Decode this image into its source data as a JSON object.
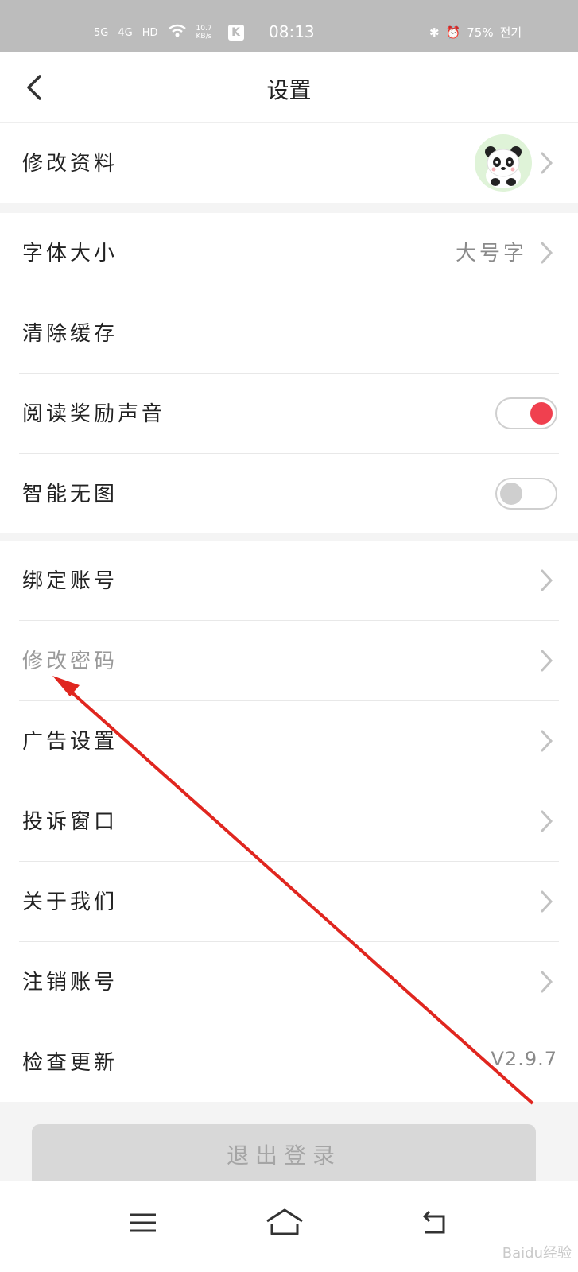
{
  "status_bar": {
    "network_1": "5G",
    "network_2": "4G",
    "hd": "HD",
    "speed": "10.7 KB/s",
    "time": "08:13",
    "battery": "75%",
    "carrier": "전기"
  },
  "header": {
    "title": "设置"
  },
  "section1": {
    "edit_profile": "修改资料"
  },
  "section2": {
    "font_size": "字体大小",
    "font_size_value": "大号字",
    "clear_cache": "清除缓存",
    "read_reward_sound": "阅读奖励声音",
    "read_reward_sound_on": true,
    "smart_no_image": "智能无图",
    "smart_no_image_on": false
  },
  "section3": {
    "bind_account": "绑定账号",
    "change_password": "修改密码",
    "ad_settings": "广告设置",
    "complaint_window": "投诉窗口",
    "about_us": "关于我们",
    "cancel_account": "注销账号",
    "check_update": "检查更新",
    "version": "V2.9.7"
  },
  "logout": "退出登录",
  "watermark": "Baidu经验",
  "colors": {
    "accent": "#f0404f",
    "annotation_arrow": "#e0261f"
  }
}
